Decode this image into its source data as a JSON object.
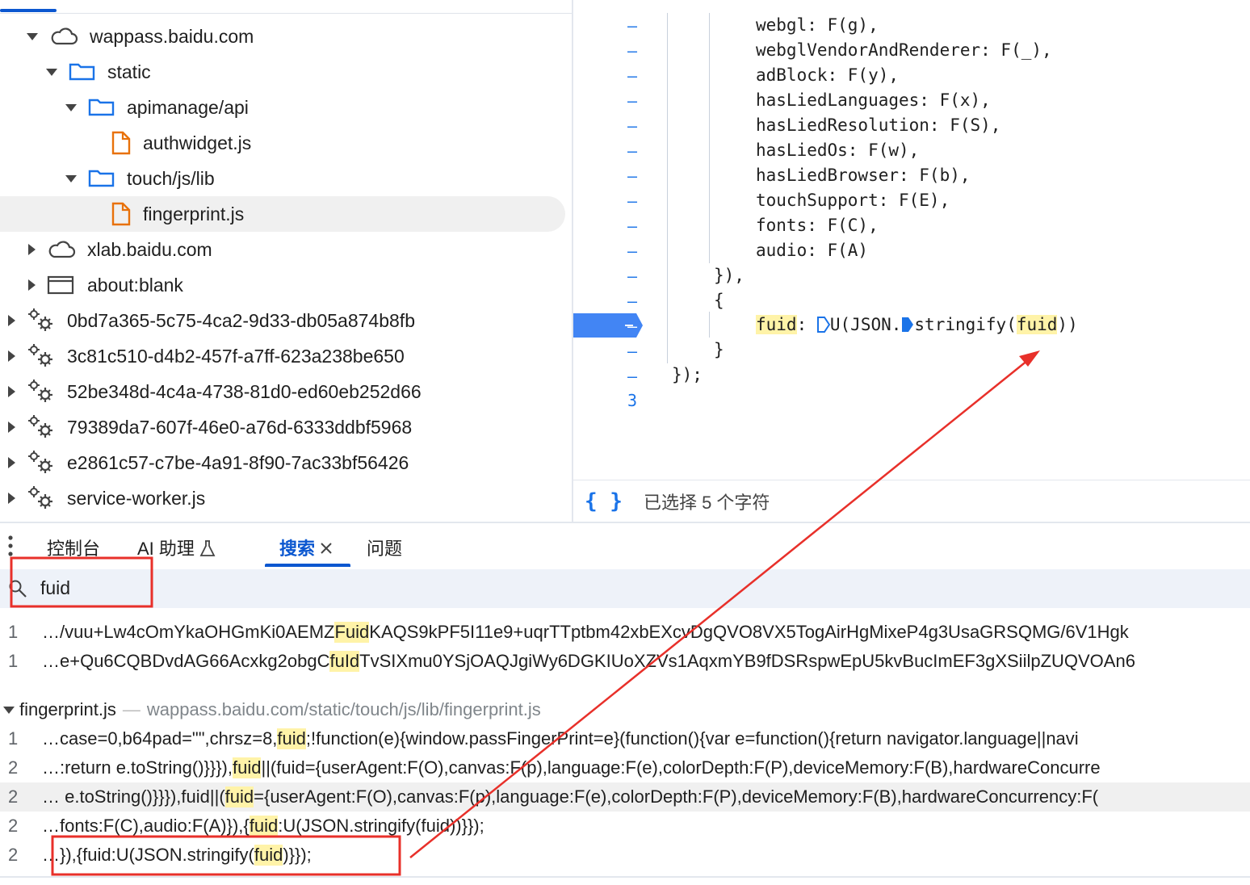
{
  "file_tree": {
    "items": [
      {
        "label": "wappass.baidu.com",
        "icon": "cloud-icon",
        "expanded": true
      },
      {
        "label": "static",
        "icon": "folder-icon",
        "expanded": true
      },
      {
        "label": "apimanage/api",
        "icon": "folder-icon",
        "expanded": true
      },
      {
        "label": "authwidget.js",
        "icon": "file-icon"
      },
      {
        "label": "touch/js/lib",
        "icon": "folder-icon",
        "expanded": true
      },
      {
        "label": "fingerprint.js",
        "icon": "file-icon",
        "selected": true
      },
      {
        "label": "xlab.baidu.com",
        "icon": "cloud-icon",
        "expanded": false
      },
      {
        "label": "about:blank",
        "icon": "frame-icon",
        "expanded": false
      },
      {
        "label": "0bd7a365-5c75-4ca2-9d33-db05a874b8fb",
        "icon": "gear-icon",
        "expanded": false
      },
      {
        "label": "3c81c510-d4b2-457f-a7ff-623a238be650",
        "icon": "gear-icon",
        "expanded": false
      },
      {
        "label": "52be348d-4c4a-4738-81d0-ed60eb252d66",
        "icon": "gear-icon",
        "expanded": false
      },
      {
        "label": "79389da7-607f-46e0-a76d-6333ddbf5968",
        "icon": "gear-icon",
        "expanded": false
      },
      {
        "label": "e2861c57-c7be-4a91-8f90-7ac33bf56426",
        "icon": "gear-icon",
        "expanded": false
      },
      {
        "label": "service-worker.js",
        "icon": "gear-icon",
        "expanded": false
      }
    ]
  },
  "editor": {
    "gutter": [
      "–",
      "–",
      "–",
      "–",
      "–",
      "–",
      "–",
      "–",
      "–",
      "–",
      "–",
      "–",
      "–",
      "–",
      "–",
      "3"
    ],
    "lines": [
      "webgl: F(g),",
      "webglVendorAndRenderer: F(_),",
      "adBlock: F(y),",
      "hasLiedLanguages: F(x),",
      "hasLiedResolution: F(S),",
      "hasLiedOs: F(w),",
      "hasLiedBrowser: F(b),",
      "touchSupport: F(E),",
      "fonts: F(C),",
      "audio: F(A)",
      "}),",
      "{",
      "",
      "}",
      "});"
    ],
    "fuid_line": {
      "key": "fuid",
      "colon": ":",
      "call": "U(JSON.",
      "method": "stringify(",
      "arg": "fuid",
      "close": "))"
    },
    "status": "已选择 5 个字符",
    "format_icon": "braces-icon"
  },
  "drawer": {
    "tabs": [
      "控制台",
      "AI 助理",
      "搜索",
      "问题"
    ],
    "active_tab": "搜索"
  },
  "search": {
    "query": "fuid"
  },
  "results": {
    "top_rows": [
      {
        "line": "1",
        "pre": "…/vuu+Lw4cOmYkaOHGmKi0AEMZ",
        "match": "Fuid",
        "post": "KAQS9kPF5I11e9+uqrTTptbm42xbEXcvDgQVO8VX5TogAirHgMixeP4g3UsaGRSQMG/6V1Hgk"
      },
      {
        "line": "1",
        "pre": "…e+Qu6CQBDvdAG66Acxkg2obgC",
        "match": "fuId",
        "post": "TvSIXmu0YSjOAQJgiWy6DGKIUoXZVs1AqxmYB9fDSRspwEpU5kvBucImEF3gXSiilpZUQVOAn6"
      }
    ],
    "file_group": {
      "name": "fingerprint.js",
      "separator": "—",
      "path": "wappass.baidu.com/static/touch/js/lib/fingerprint.js"
    },
    "file_rows": [
      {
        "line": "1",
        "pre": "…case=0,b64pad=\"\",chrsz=8,",
        "match": "fuid",
        "post": ";!function(e){window.passFingerPrint=e}(function(){var e=function(){return navigator.language||navi"
      },
      {
        "line": "2",
        "pre": "…:return e.toString()}}}),",
        "match": "fuid",
        "post": "||(fuid={userAgent:F(O),canvas:F(p),language:F(e),colorDepth:F(P),deviceMemory:F(B),hardwareConcurre"
      },
      {
        "line": "2",
        "pre": "… e.toString()}}}),fuid||(",
        "match": "fuid",
        "post": "={userAgent:F(O),canvas:F(p),language:F(e),colorDepth:F(P),deviceMemory:F(B),hardwareConcurrency:F("
      },
      {
        "line": "2",
        "pre": "…fonts:F(C),audio:F(A)}),{",
        "match": "fuid",
        "post": ":U(JSON.stringify(fuid))}});"
      },
      {
        "line": "2",
        "pre": "…}),{fuid:U(JSON.stringify(",
        "match": "fuid",
        "post": ")}});"
      }
    ]
  },
  "colors": {
    "accent": "#0b57d0",
    "highlight": "#fff3a8",
    "annotation": "#e8302a",
    "file_icon": "#e8710a"
  }
}
